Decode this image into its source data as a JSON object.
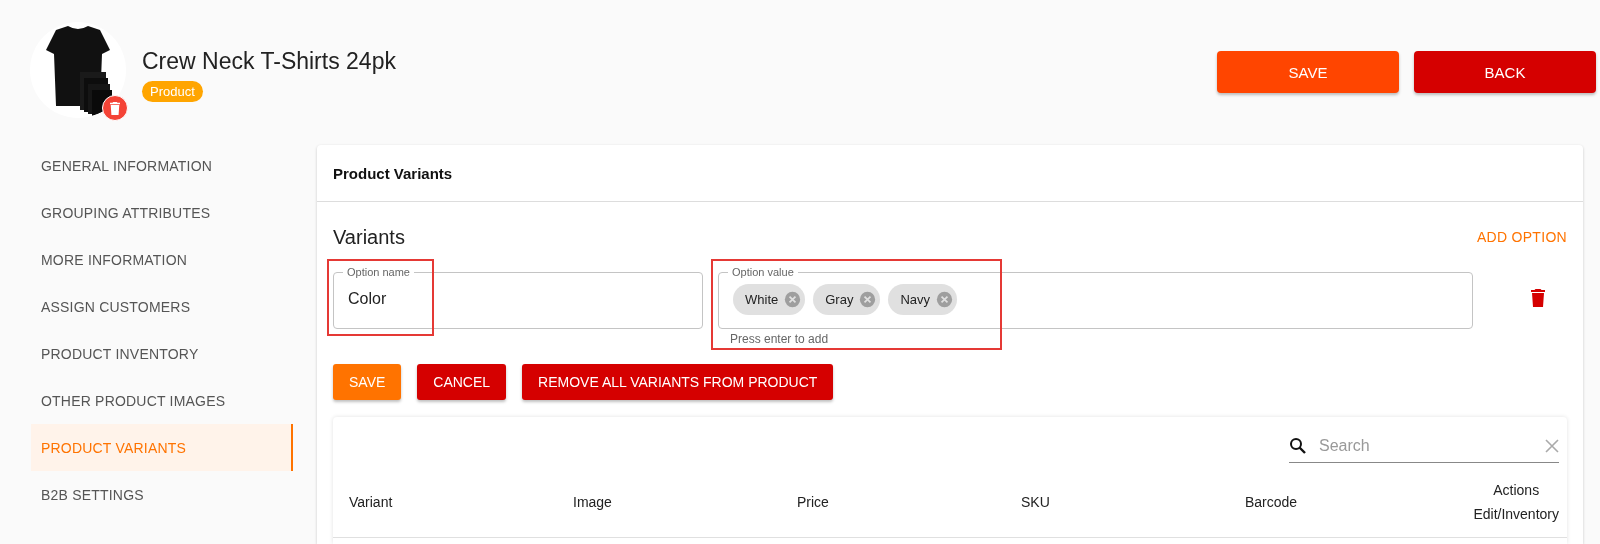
{
  "product": {
    "title": "Crew Neck T-Shirts 24pk",
    "badge": "Product"
  },
  "header_buttons": [
    {
      "label": "SAVE",
      "kind": "save"
    },
    {
      "label": "BACK",
      "kind": "back"
    }
  ],
  "sidebar": {
    "items": [
      {
        "label": "GENERAL INFORMATION",
        "selected": false
      },
      {
        "label": "GROUPING ATTRIBUTES",
        "selected": false
      },
      {
        "label": "MORE INFORMATION",
        "selected": false
      },
      {
        "label": "ASSIGN CUSTOMERS",
        "selected": false
      },
      {
        "label": "PRODUCT INVENTORY",
        "selected": false
      },
      {
        "label": "OTHER PRODUCT IMAGES",
        "selected": false
      },
      {
        "label": "PRODUCT VARIANTS",
        "selected": true
      },
      {
        "label": "B2B SETTINGS",
        "selected": false
      }
    ]
  },
  "card": {
    "title": "Product Variants",
    "section_title": "Variants",
    "add_option": "ADD OPTION",
    "option_name": {
      "label": "Option name",
      "value": "Color",
      "highlighted": true
    },
    "option_value": {
      "label": "Option value",
      "chips": [
        "White",
        "Gray",
        "Navy"
      ],
      "helper": "Press enter to add",
      "highlighted": true
    },
    "buttons": [
      {
        "label": "SAVE",
        "kind": "save"
      },
      {
        "label": "CANCEL",
        "kind": "danger"
      },
      {
        "label": "REMOVE ALL VARIANTS FROM PRODUCT",
        "kind": "danger"
      }
    ],
    "table": {
      "search": {
        "placeholder": "Search"
      },
      "columns": [
        {
          "label": "Variant"
        },
        {
          "label": "Image"
        },
        {
          "label": "Price"
        },
        {
          "label": "SKU"
        },
        {
          "label": "Barcode"
        },
        {
          "label": "Actions",
          "sublabel": "Edit/Inventory"
        }
      ]
    }
  }
}
